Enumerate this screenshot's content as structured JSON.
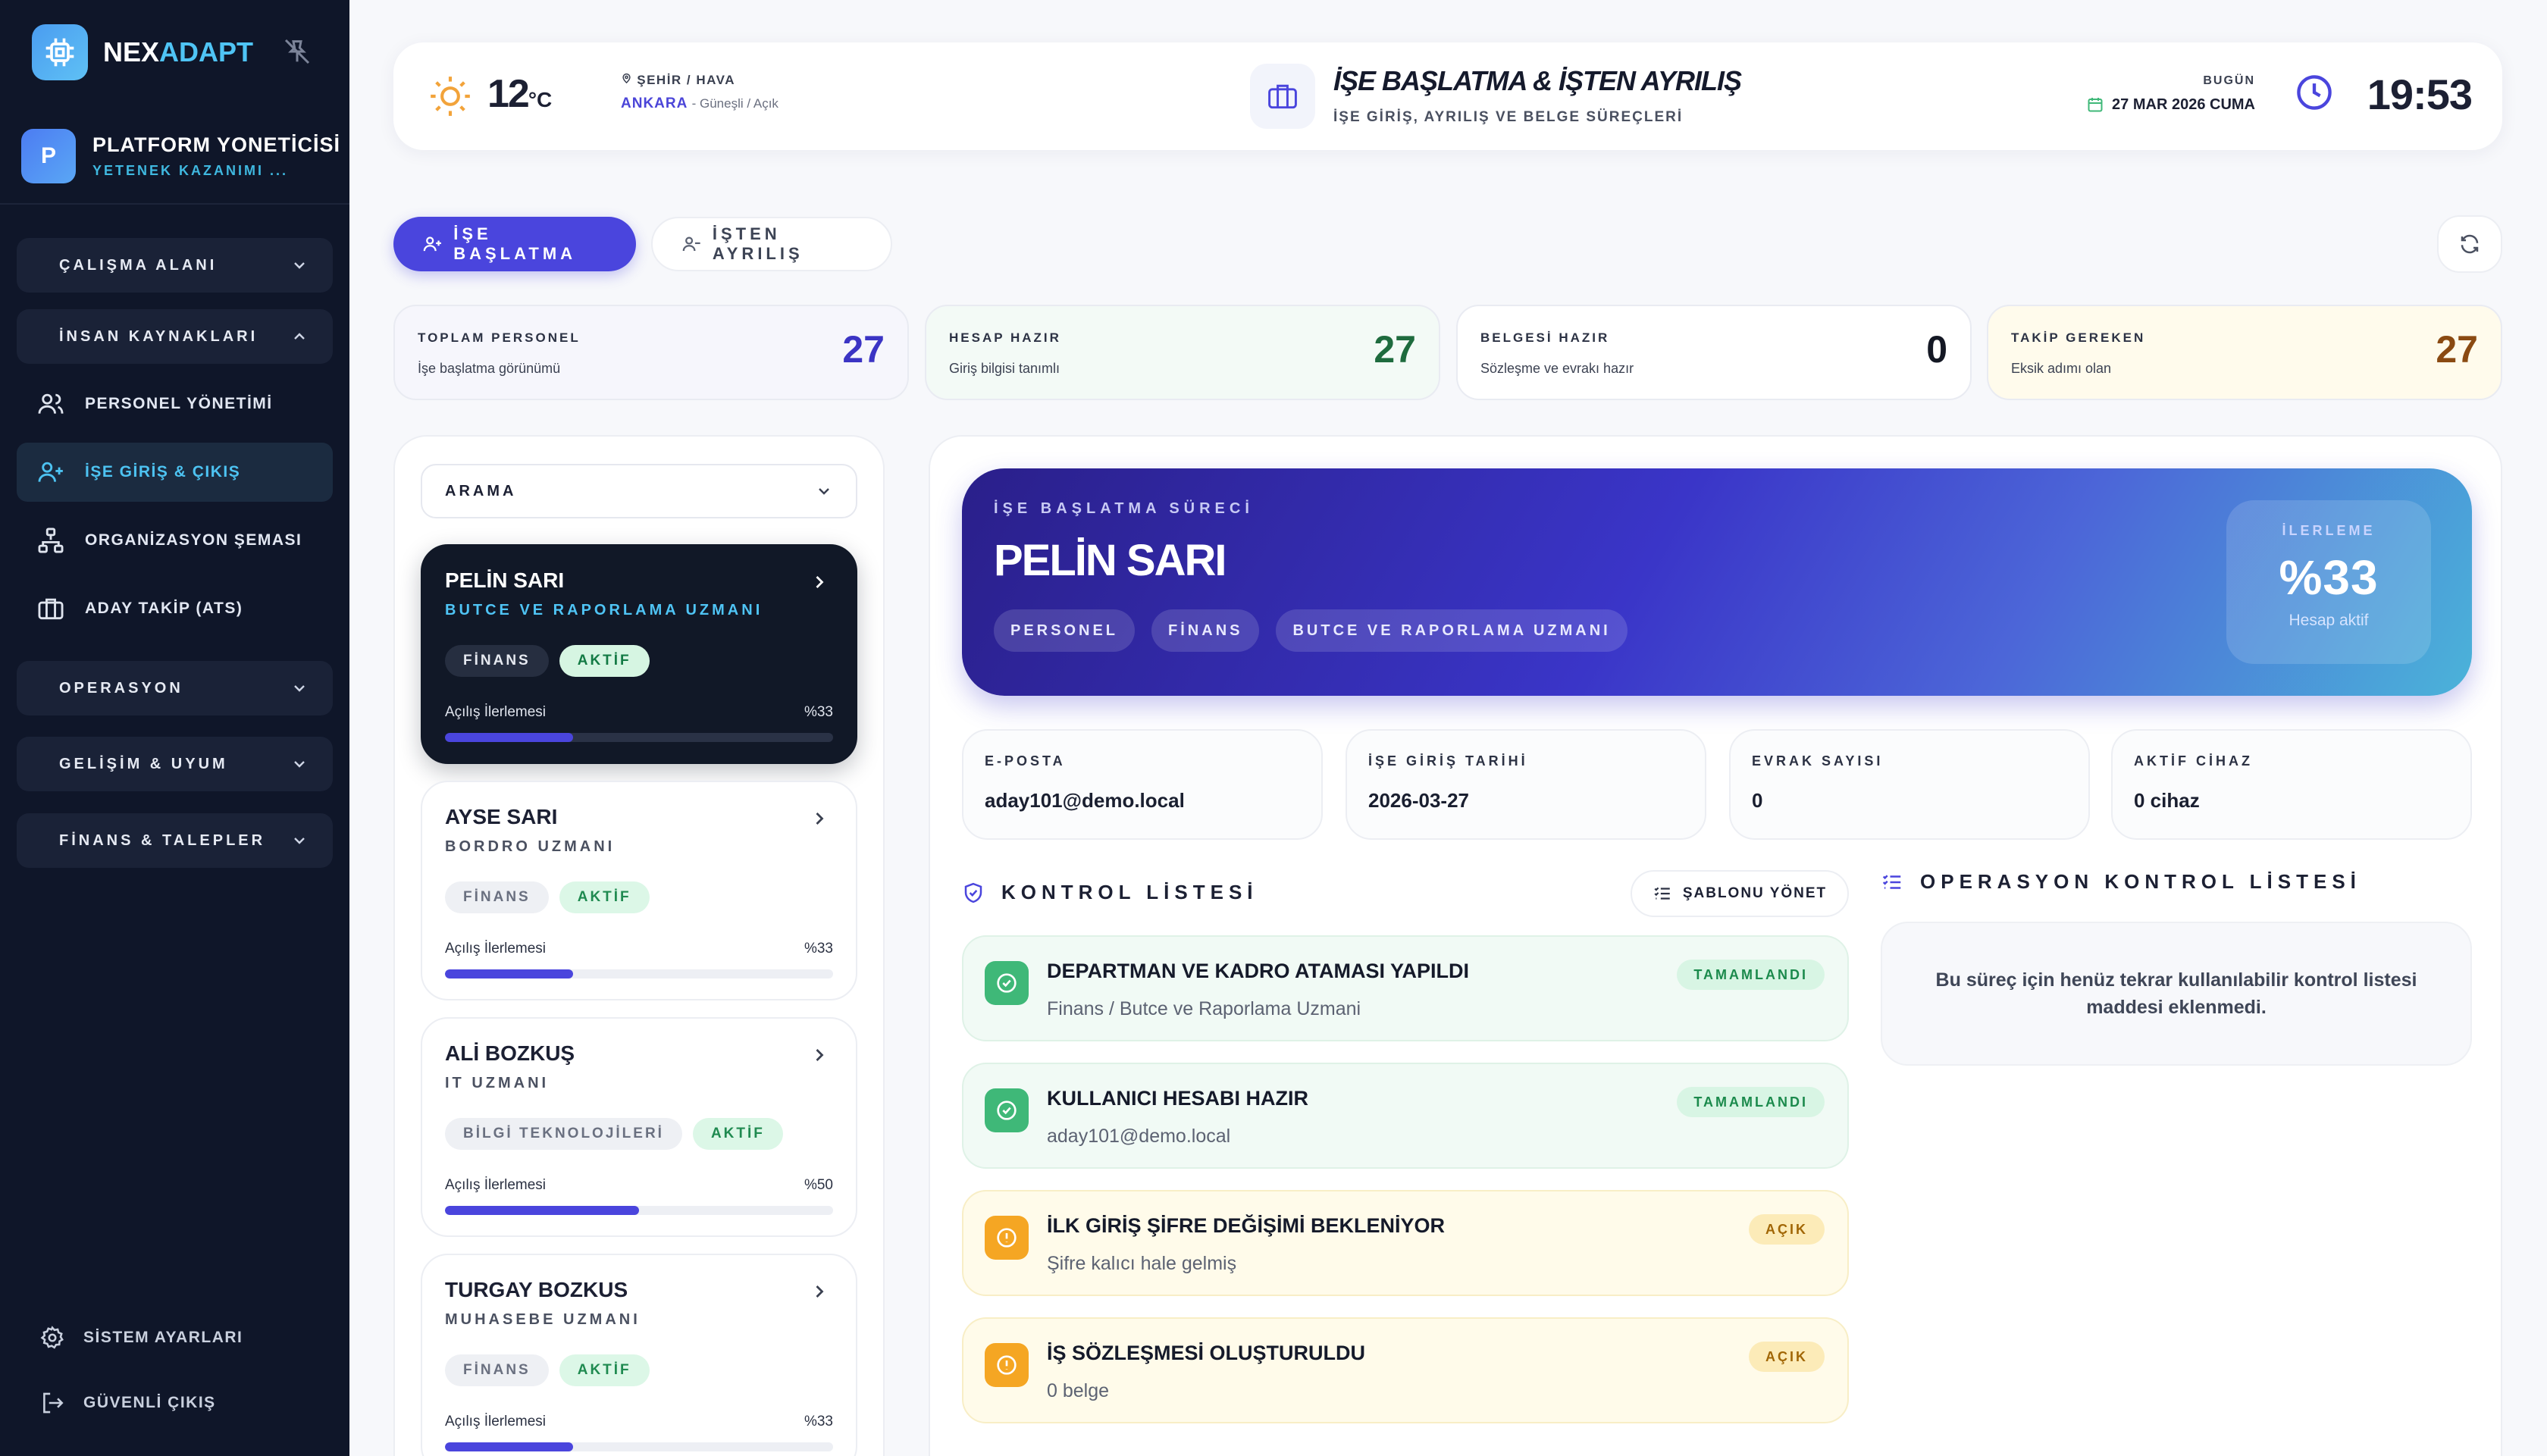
{
  "brand": {
    "name_a": "NEX",
    "name_b": "ADAPT"
  },
  "user": {
    "initial": "P",
    "name": "PLATFORM YONETİCİSİ",
    "sub": "YETENEK KAZANIMI ..."
  },
  "sidebar": {
    "sections": [
      {
        "label": "ÇALIŞMA ALANI"
      },
      {
        "label": "İNSAN KAYNAKLARI"
      },
      {
        "label": "OPERASYON"
      },
      {
        "label": "GELİŞİM & UYUM"
      },
      {
        "label": "FİNANS & TALEPLER"
      }
    ],
    "items": [
      {
        "label": "PERSONEL YÖNETİMİ"
      },
      {
        "label": "İŞE GİRİŞ & ÇIKIŞ"
      },
      {
        "label": "ORGANİZASYON ŞEMASI"
      },
      {
        "label": "ADAY TAKİP (ATS)"
      }
    ],
    "footer": {
      "settings": "SİSTEM AYARLARI",
      "logout": "GÜVENLİ ÇIKIŞ"
    }
  },
  "header": {
    "temp": "12",
    "temp_unit": "°C",
    "loc_label": "ŞEHİR / HAVA",
    "city": "ANKARA",
    "weather": "- Güneşli / Açık",
    "title": "İŞE BAŞLATMA & İŞTEN AYRILIŞ",
    "subtitle": "İŞE GİRİŞ, AYRILIŞ VE BELGE SÜREÇLERİ",
    "today_label": "BUGÜN",
    "today": "27 MAR 2026 CUMA",
    "time": "19:53"
  },
  "tabs": {
    "onboarding": "İŞE BAŞLATMA",
    "offboarding": "İŞTEN AYRILIŞ"
  },
  "stats": [
    {
      "label": "TOPLAM PERSONEL",
      "sub": "İşe başlatma görünümü",
      "value": "27",
      "color": "#3b34c4",
      "bg": "#f6f6fc"
    },
    {
      "label": "HESAP HAZIR",
      "sub": "Giriş bilgisi tanımlı",
      "value": "27",
      "color": "#1e6b3e",
      "bg": "#f3faf6"
    },
    {
      "label": "BELGESİ HAZIR",
      "sub": "Sözleşme ve evrakı hazır",
      "value": "0",
      "color": "#141824",
      "bg": "#ffffff"
    },
    {
      "label": "TAKİP GEREKEN",
      "sub": "Eksik adımı olan",
      "value": "27",
      "color": "#8a4a12",
      "bg": "#fffbec"
    }
  ],
  "list": {
    "search_label": "ARAMA",
    "progress_label": "Açılış İlerlemesi",
    "people": [
      {
        "name": "PELİN SARI",
        "role": "BUTCE VE RAPORLAMA UZMANI",
        "dept": "FİNANS",
        "status": "AKTİF",
        "progress": "%33",
        "pct": 33
      },
      {
        "name": "AYSE SARI",
        "role": "BORDRO UZMANI",
        "dept": "FİNANS",
        "status": "AKTİF",
        "progress": "%33",
        "pct": 33
      },
      {
        "name": "ALİ BOZKUŞ",
        "role": "IT UZMANI",
        "dept": "BİLGİ TEKNOLOJİLERİ",
        "status": "AKTİF",
        "progress": "%50",
        "pct": 50
      },
      {
        "name": "TURGAY BOZKUS",
        "role": "MUHASEBE UZMANI",
        "dept": "FİNANS",
        "status": "AKTİF",
        "progress": "%33",
        "pct": 33
      }
    ]
  },
  "detail": {
    "kicker": "İŞE BAŞLATMA SÜRECİ",
    "name": "PELİN SARI",
    "chips": [
      "PERSONEL",
      "FİNANS",
      "BUTCE VE RAPORLAMA UZMANI"
    ],
    "progress_label": "İLERLEME",
    "progress_value": "%33",
    "progress_sub": "Hesap aktif",
    "info": [
      {
        "label": "E-POSTA",
        "value": "aday101@demo.local"
      },
      {
        "label": "İŞE GİRİŞ TARİHİ",
        "value": "2026-03-27"
      },
      {
        "label": "EVRAK SAYISI",
        "value": "0"
      },
      {
        "label": "AKTİF CİHAZ",
        "value": "0 cihaz"
      }
    ],
    "checklist_title": "KONTROL LİSTESİ",
    "template_button": "ŞABLONU YÖNET",
    "checklist": [
      {
        "title": "DEPARTMAN VE KADRO ATAMASI YAPILDI",
        "desc": "Finans / Butce ve Raporlama Uzmani",
        "status": "TAMAMLANDI"
      },
      {
        "title": "KULLANICI HESABI HAZIR",
        "desc": "aday101@demo.local",
        "status": "TAMAMLANDI"
      },
      {
        "title": "İLK GİRİŞ ŞİFRE DEĞİŞİMİ BEKLENİYOR",
        "desc": "Şifre kalıcı hale gelmiş",
        "status": "AÇIK"
      },
      {
        "title": "İŞ SÖZLEŞMESİ OLUŞTURULDU",
        "desc": "0 belge",
        "status": "AÇIK"
      }
    ],
    "ops_title": "OPERASYON KONTROL LİSTESİ",
    "ops_empty": "Bu süreç için henüz tekrar kullanılabilir kontrol listesi maddesi eklenmedi."
  }
}
